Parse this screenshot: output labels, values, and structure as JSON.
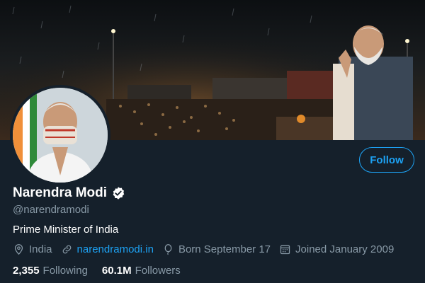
{
  "profile": {
    "display_name": "Narendra Modi",
    "handle": "@narendramodi",
    "bio": "Prime Minister of India",
    "verified": true,
    "verified_icon": "verified-badge-icon"
  },
  "meta": {
    "location": "India",
    "location_icon": "location-pin-icon",
    "website": "narendramodi.in",
    "website_icon": "link-icon",
    "birthday": "Born September 17",
    "birthday_icon": "balloon-icon",
    "joined": "Joined January 2009",
    "joined_icon": "calendar-icon"
  },
  "stats": {
    "following_count": "2,355",
    "following_label": "Following",
    "followers_count": "60.1M",
    "followers_label": "Followers"
  },
  "actions": {
    "follow_label": "Follow"
  },
  "colors": {
    "background": "#15202b",
    "accent": "#1da1f2",
    "secondary_text": "#8899a6",
    "primary_text": "#ffffff"
  }
}
